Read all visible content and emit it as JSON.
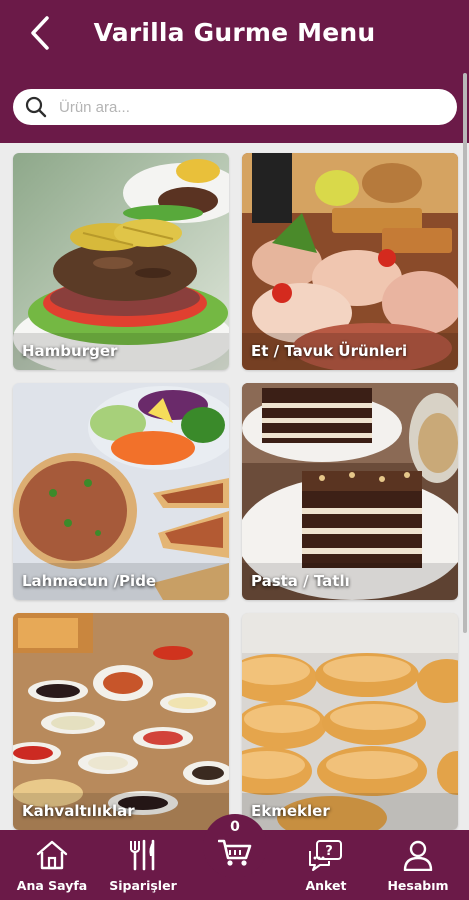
{
  "header": {
    "title": "Varilla Gurme Menu",
    "back_icon": "chevron-left-icon"
  },
  "search": {
    "placeholder": "Ürün ara...",
    "value": "",
    "icon": "search-icon"
  },
  "categories": [
    {
      "label": "Hamburger",
      "image": "hamburger-photo"
    },
    {
      "label": "Et / Tavuk Ürünleri",
      "image": "meat-chicken-photo"
    },
    {
      "label": "Lahmacun /Pide",
      "image": "lahmacun-pide-photo"
    },
    {
      "label": "Pasta / Tatlı",
      "image": "cake-dessert-photo"
    },
    {
      "label": "Kahvaltılıklar",
      "image": "breakfast-spread-photo"
    },
    {
      "label": "Ekmekler",
      "image": "bread-rolls-photo"
    }
  ],
  "bottom_nav": {
    "home": {
      "label": "Ana Sayfa",
      "icon": "home-icon"
    },
    "orders": {
      "label": "Siparişler",
      "icon": "cutlery-icon"
    },
    "cart": {
      "count": "0",
      "icon": "cart-icon"
    },
    "survey": {
      "label": "Anket",
      "icon": "survey-chat-icon"
    },
    "account": {
      "label": "Hesabım",
      "icon": "user-icon"
    }
  },
  "colors": {
    "brand": "#6b1a48",
    "background": "#ececec"
  }
}
